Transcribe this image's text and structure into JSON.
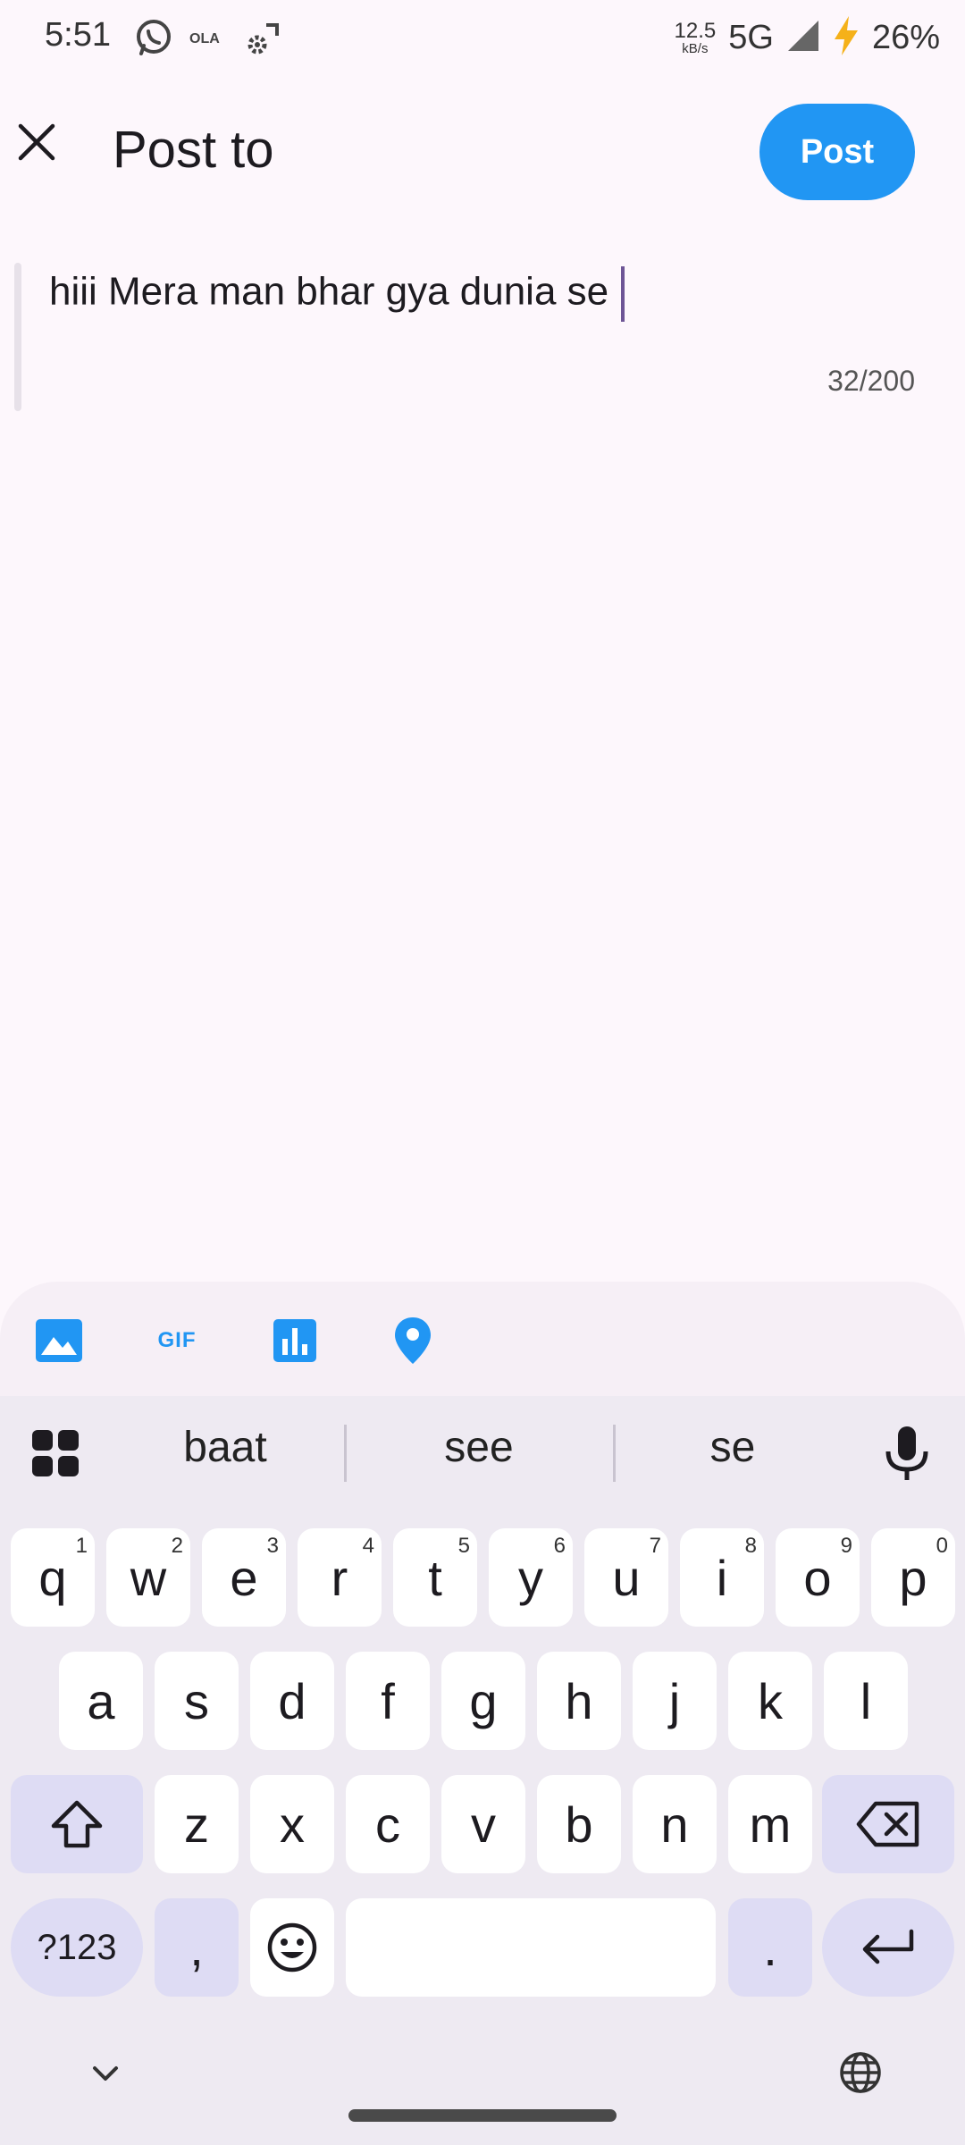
{
  "status_bar": {
    "time": "5:51",
    "net_speed_value": "12.5",
    "net_speed_unit": "kB/s",
    "network": "5G",
    "battery": "26%"
  },
  "header": {
    "title": "Post to",
    "post_label": "Post"
  },
  "composer": {
    "text": "hiii Mera man bhar gya dunia se",
    "counter": "32/200"
  },
  "attachments": {
    "gif_label": "GIF"
  },
  "keyboard": {
    "suggestions": [
      "baat",
      "see",
      "se"
    ],
    "row1": [
      {
        "k": "q",
        "h": "1"
      },
      {
        "k": "w",
        "h": "2"
      },
      {
        "k": "e",
        "h": "3"
      },
      {
        "k": "r",
        "h": "4"
      },
      {
        "k": "t",
        "h": "5"
      },
      {
        "k": "y",
        "h": "6"
      },
      {
        "k": "u",
        "h": "7"
      },
      {
        "k": "i",
        "h": "8"
      },
      {
        "k": "o",
        "h": "9"
      },
      {
        "k": "p",
        "h": "0"
      }
    ],
    "row2": [
      "a",
      "s",
      "d",
      "f",
      "g",
      "h",
      "j",
      "k",
      "l"
    ],
    "row3": [
      "z",
      "x",
      "c",
      "v",
      "b",
      "n",
      "m"
    ],
    "symbols_label": "?123",
    "comma_label": ",",
    "period_label": "."
  },
  "colors": {
    "accent": "#2196f3",
    "background": "#fdf7fc",
    "keyboard_bg": "#eeeaf2",
    "modifier_key": "#dedcf4"
  }
}
